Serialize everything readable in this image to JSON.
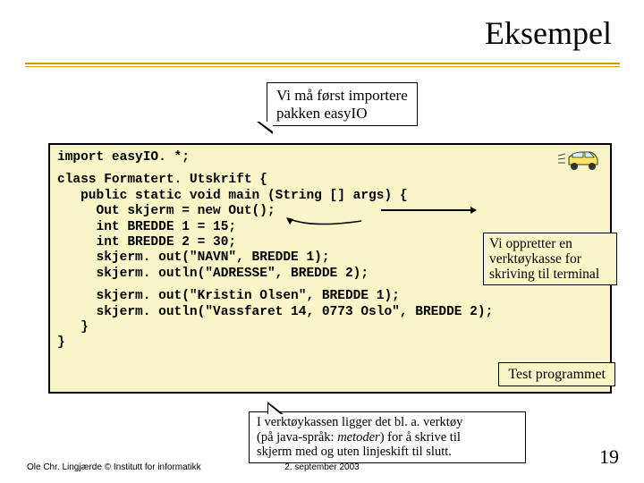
{
  "title": "Eksempel",
  "callout_top": {
    "line1": "Vi må først importere",
    "line2": "pakken easyIO"
  },
  "code": {
    "l1": "import easyIO. *;",
    "l2": "class Formatert. Utskrift {",
    "l3": "   public static void main (String [] args) {",
    "l4": "     Out skjerm = new Out();",
    "l5": "     int BREDDE 1 = 15;",
    "l6": "     int BREDDE 2 = 30;",
    "l7": "     skjerm. out(\"NAVN\", BREDDE 1);",
    "l8": "     skjerm. outln(\"ADRESSE\", BREDDE 2);",
    "l9": "     skjerm. out(\"Kristin Olsen\", BREDDE 1);",
    "l10": "     skjerm. outln(\"Vassfaret 14, 0773 Oslo\", BREDDE 2);",
    "l11": "   }",
    "l12": "}"
  },
  "ann_right": {
    "l1": "Vi oppretter en",
    "l2": "verktøykasse for",
    "l3": "skriving til terminal"
  },
  "ann_test": "Test programmet",
  "callout_bottom": {
    "l1": "I verktøykassen ligger det bl. a. verktøy",
    "l2a": "(på java-språk: ",
    "l2b": "metoder",
    "l2c": ") for å skrive til",
    "l3": "skjerm med og uten linjeskift til slutt."
  },
  "footer": {
    "left": "Ole Chr. Lingjærde © Institutt for informatikk",
    "center": "2. september 2003",
    "page": "19"
  }
}
